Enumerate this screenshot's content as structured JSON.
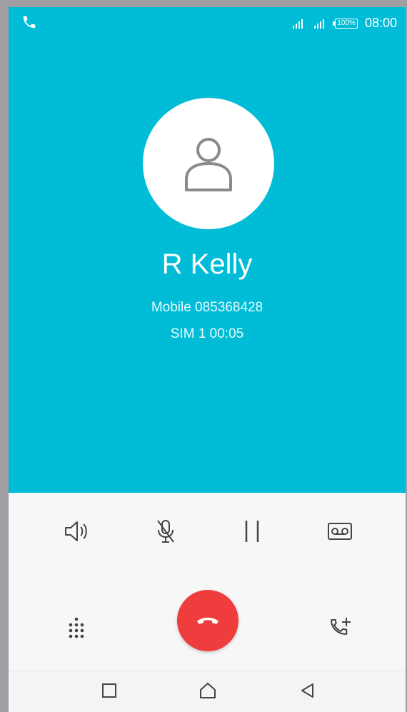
{
  "status": {
    "time": "08:00",
    "battery": "100%",
    "signal_icons": [
      "signal-icon",
      "signal-icon"
    ],
    "call_icon": "phone-icon"
  },
  "contact": {
    "name": "R Kelly",
    "line1": "Mobile  085368428",
    "line2": "SIM 1  00:05",
    "avatar_icon": "person-icon"
  },
  "controls": {
    "speaker_icon": "speaker-icon",
    "mute_icon": "microphone-off-icon",
    "hold_icon": "pause-icon",
    "record_icon": "voicemail-icon",
    "dialpad_icon": "dialpad-icon",
    "end_call_icon": "end-call-icon",
    "add_call_icon": "add-call-icon"
  },
  "navigation": {
    "recent_icon": "square-icon",
    "home_icon": "home-icon",
    "back_icon": "back-icon"
  },
  "colors": {
    "call_background": "#00bcd6",
    "end_call": "#ef3c3c",
    "icon": "#444444"
  }
}
